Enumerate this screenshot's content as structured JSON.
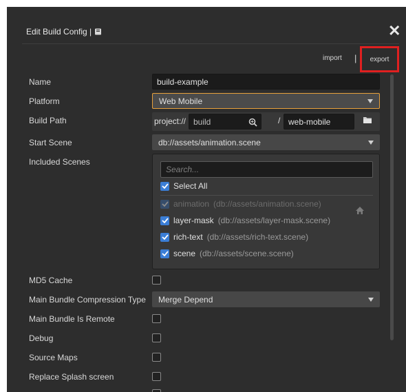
{
  "dialog": {
    "title": "Edit Build Config |",
    "close_glyph": "✕",
    "import_label": "import",
    "separator": "|",
    "export_label": "export",
    "highlight_color": "#e02020"
  },
  "form": {
    "name": {
      "label": "Name",
      "value": "build-example"
    },
    "platform": {
      "label": "Platform",
      "value": "Web Mobile"
    },
    "build_path": {
      "label": "Build Path",
      "prefix": "project://",
      "value": "build",
      "separator": "/",
      "folder": "web-mobile"
    },
    "start_scene": {
      "label": "Start Scene",
      "value": "db://assets/animation.scene"
    },
    "included_scenes": {
      "label": "Included Scenes",
      "search_placeholder": "Search...",
      "select_all_label": "Select All",
      "select_all_checked": true,
      "items": [
        {
          "name": "animation",
          "path": "(db://assets/animation.scene)",
          "checked": true,
          "disabled": true,
          "icon": "home-icon"
        },
        {
          "name": "layer-mask",
          "path": "(db://assets/layer-mask.scene)",
          "checked": true,
          "disabled": false
        },
        {
          "name": "rich-text",
          "path": "(db://assets/rich-text.scene)",
          "checked": true,
          "disabled": false
        },
        {
          "name": "scene",
          "path": "(db://assets/scene.scene)",
          "checked": true,
          "disabled": false
        }
      ]
    },
    "md5_cache": {
      "label": "MD5 Cache",
      "checked": false
    },
    "compression": {
      "label": "Main Bundle Compression Type",
      "value": "Merge Depend"
    },
    "bundle_remote": {
      "label": "Main Bundle Is Remote",
      "checked": false
    },
    "debug": {
      "label": "Debug",
      "checked": false
    },
    "source_maps": {
      "label": "Source Maps",
      "checked": false
    },
    "replace_splash": {
      "label": "Replace Splash screen",
      "checked": false
    }
  },
  "colors": {
    "panel": "#2d2d2d",
    "checkbox_on": "#3b7ed6",
    "focus_border": "#e8a13b"
  }
}
